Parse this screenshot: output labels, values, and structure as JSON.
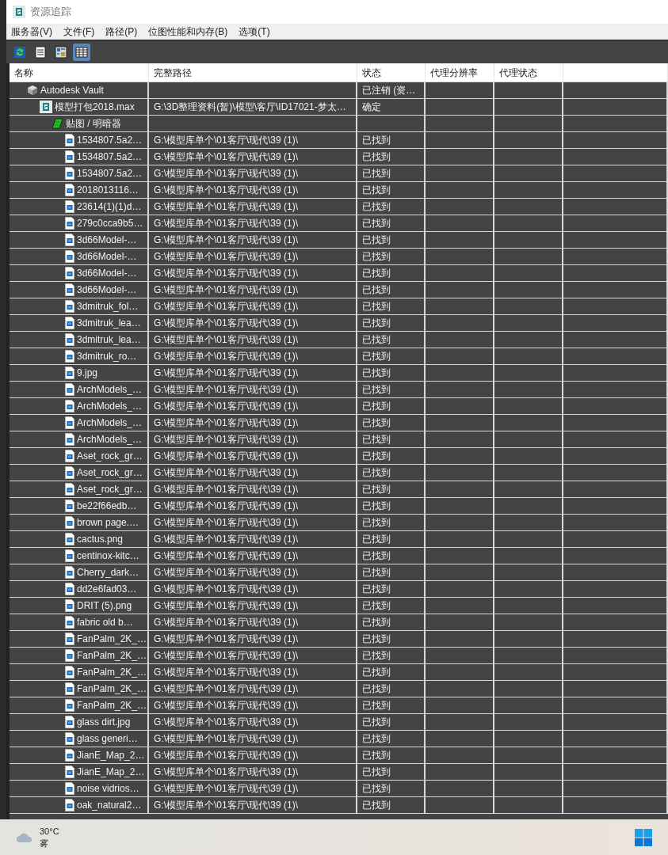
{
  "window": {
    "title": "资源追踪"
  },
  "menu": [
    "服务器(V)",
    "文件(F)",
    "路径(P)",
    "位图性能和内存(B)",
    "选项(T)"
  ],
  "toolbar": [
    {
      "kind": "refresh",
      "selected": false
    },
    {
      "kind": "list",
      "selected": false
    },
    {
      "kind": "thumbnail",
      "selected": false
    },
    {
      "kind": "grid",
      "selected": true
    }
  ],
  "columns": [
    "名称",
    "完整路径",
    "状态",
    "代理分辨率",
    "代理状态"
  ],
  "tree": [
    {
      "kind": "vault",
      "name": "Autodesk Vault",
      "status": "已注销 (资…",
      "children": [
        {
          "kind": "scene",
          "name": "模型打包2018.max",
          "path": "G:\\3D整理资料(暂)\\模型\\客厅\\ID17021-梦太…",
          "status": "确定",
          "children": [
            {
              "kind": "maps",
              "name": "贴图 / 明暗器",
              "children": [
                {
                  "kind": "image",
                  "name": "1534807.5a2…",
                  "path": "G:\\模型库单个\\01客厅\\现代\\39 (1)\\",
                  "status": "已找到"
                },
                {
                  "kind": "image",
                  "name": "1534807.5a2…",
                  "path": "G:\\模型库单个\\01客厅\\现代\\39 (1)\\",
                  "status": "已找到"
                },
                {
                  "kind": "image",
                  "name": "1534807.5a2…",
                  "path": "G:\\模型库单个\\01客厅\\现代\\39 (1)\\",
                  "status": "已找到"
                },
                {
                  "kind": "image",
                  "name": "2018013116…",
                  "path": "G:\\模型库单个\\01客厅\\现代\\39 (1)\\",
                  "status": "已找到"
                },
                {
                  "kind": "image",
                  "name": "23614(1)(1)d…",
                  "path": "G:\\模型库单个\\01客厅\\现代\\39 (1)\\",
                  "status": "已找到"
                },
                {
                  "kind": "image",
                  "name": "279c0cca9b5…",
                  "path": "G:\\模型库单个\\01客厅\\现代\\39 (1)\\",
                  "status": "已找到"
                },
                {
                  "kind": "image",
                  "name": "3d66Model-…",
                  "path": "G:\\模型库单个\\01客厅\\现代\\39 (1)\\",
                  "status": "已找到"
                },
                {
                  "kind": "image",
                  "name": "3d66Model-…",
                  "path": "G:\\模型库单个\\01客厅\\现代\\39 (1)\\",
                  "status": "已找到"
                },
                {
                  "kind": "image",
                  "name": "3d66Model-…",
                  "path": "G:\\模型库单个\\01客厅\\现代\\39 (1)\\",
                  "status": "已找到"
                },
                {
                  "kind": "image",
                  "name": "3d66Model-…",
                  "path": "G:\\模型库单个\\01客厅\\现代\\39 (1)\\",
                  "status": "已找到"
                },
                {
                  "kind": "image",
                  "name": "3dmitruk_fol…",
                  "path": "G:\\模型库单个\\01客厅\\现代\\39 (1)\\",
                  "status": "已找到"
                },
                {
                  "kind": "image",
                  "name": "3dmitruk_lea…",
                  "path": "G:\\模型库单个\\01客厅\\现代\\39 (1)\\",
                  "status": "已找到"
                },
                {
                  "kind": "image",
                  "name": "3dmitruk_lea…",
                  "path": "G:\\模型库单个\\01客厅\\现代\\39 (1)\\",
                  "status": "已找到"
                },
                {
                  "kind": "image",
                  "name": "3dmitruk_ro…",
                  "path": "G:\\模型库单个\\01客厅\\现代\\39 (1)\\",
                  "status": "已找到"
                },
                {
                  "kind": "image",
                  "name": "9.jpg",
                  "path": "G:\\模型库单个\\01客厅\\现代\\39 (1)\\",
                  "status": "已找到"
                },
                {
                  "kind": "image",
                  "name": "ArchModels_…",
                  "path": "G:\\模型库单个\\01客厅\\现代\\39 (1)\\",
                  "status": "已找到"
                },
                {
                  "kind": "image",
                  "name": "ArchModels_…",
                  "path": "G:\\模型库单个\\01客厅\\现代\\39 (1)\\",
                  "status": "已找到"
                },
                {
                  "kind": "image",
                  "name": "ArchModels_…",
                  "path": "G:\\模型库单个\\01客厅\\现代\\39 (1)\\",
                  "status": "已找到"
                },
                {
                  "kind": "image",
                  "name": "ArchModels_…",
                  "path": "G:\\模型库单个\\01客厅\\现代\\39 (1)\\",
                  "status": "已找到"
                },
                {
                  "kind": "image",
                  "name": "Aset_rock_gr…",
                  "path": "G:\\模型库单个\\01客厅\\现代\\39 (1)\\",
                  "status": "已找到"
                },
                {
                  "kind": "image",
                  "name": "Aset_rock_gr…",
                  "path": "G:\\模型库单个\\01客厅\\现代\\39 (1)\\",
                  "status": "已找到"
                },
                {
                  "kind": "image",
                  "name": "Aset_rock_gr…",
                  "path": "G:\\模型库单个\\01客厅\\现代\\39 (1)\\",
                  "status": "已找到"
                },
                {
                  "kind": "image",
                  "name": "be22f66edb…",
                  "path": "G:\\模型库单个\\01客厅\\现代\\39 (1)\\",
                  "status": "已找到"
                },
                {
                  "kind": "image",
                  "name": "brown page.…",
                  "path": "G:\\模型库单个\\01客厅\\现代\\39 (1)\\",
                  "status": "已找到"
                },
                {
                  "kind": "image",
                  "name": "cactus.png",
                  "path": "G:\\模型库单个\\01客厅\\现代\\39 (1)\\",
                  "status": "已找到"
                },
                {
                  "kind": "image",
                  "name": "centinox-kitc…",
                  "path": "G:\\模型库单个\\01客厅\\现代\\39 (1)\\",
                  "status": "已找到"
                },
                {
                  "kind": "image",
                  "name": "Cherry_dark…",
                  "path": "G:\\模型库单个\\01客厅\\现代\\39 (1)\\",
                  "status": "已找到"
                },
                {
                  "kind": "image",
                  "name": "dd2e6fad03…",
                  "path": "G:\\模型库单个\\01客厅\\现代\\39 (1)\\",
                  "status": "已找到"
                },
                {
                  "kind": "image",
                  "name": "DRIT (5).png",
                  "path": "G:\\模型库单个\\01客厅\\现代\\39 (1)\\",
                  "status": "已找到"
                },
                {
                  "kind": "image",
                  "name": "fabric old b…",
                  "path": "G:\\模型库单个\\01客厅\\现代\\39 (1)\\",
                  "status": "已找到"
                },
                {
                  "kind": "image",
                  "name": "FanPalm_2K_…",
                  "path": "G:\\模型库单个\\01客厅\\现代\\39 (1)\\",
                  "status": "已找到"
                },
                {
                  "kind": "image",
                  "name": "FanPalm_2K_…",
                  "path": "G:\\模型库单个\\01客厅\\现代\\39 (1)\\",
                  "status": "已找到"
                },
                {
                  "kind": "image",
                  "name": "FanPalm_2K_…",
                  "path": "G:\\模型库单个\\01客厅\\现代\\39 (1)\\",
                  "status": "已找到"
                },
                {
                  "kind": "image",
                  "name": "FanPalm_2K_…",
                  "path": "G:\\模型库单个\\01客厅\\现代\\39 (1)\\",
                  "status": "已找到"
                },
                {
                  "kind": "image",
                  "name": "FanPalm_2K_…",
                  "path": "G:\\模型库单个\\01客厅\\现代\\39 (1)\\",
                  "status": "已找到"
                },
                {
                  "kind": "image",
                  "name": "glass dirt.jpg",
                  "path": "G:\\模型库单个\\01客厅\\现代\\39 (1)\\",
                  "status": "已找到"
                },
                {
                  "kind": "image",
                  "name": "glass generi…",
                  "path": "G:\\模型库单个\\01客厅\\现代\\39 (1)\\",
                  "status": "已找到"
                },
                {
                  "kind": "image",
                  "name": "JianE_Map_2…",
                  "path": "G:\\模型库单个\\01客厅\\现代\\39 (1)\\",
                  "status": "已找到"
                },
                {
                  "kind": "image",
                  "name": "JianE_Map_2…",
                  "path": "G:\\模型库单个\\01客厅\\现代\\39 (1)\\",
                  "status": "已找到"
                },
                {
                  "kind": "image",
                  "name": "noise vidrios…",
                  "path": "G:\\模型库单个\\01客厅\\现代\\39 (1)\\",
                  "status": "已找到"
                },
                {
                  "kind": "image",
                  "name": "oak_natural2…",
                  "path": "G:\\模型库单个\\01客厅\\现代\\39 (1)\\",
                  "status": "已找到"
                }
              ]
            }
          ]
        }
      ]
    }
  ],
  "taskbar": {
    "temperature": "30°C",
    "weather": "雾"
  }
}
